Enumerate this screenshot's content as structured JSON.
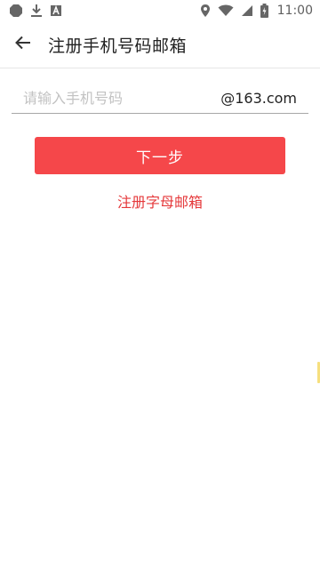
{
  "status_bar": {
    "time": "11:00",
    "left_icons": [
      "app-icon",
      "download-icon",
      "a-box-icon"
    ],
    "right_icons": [
      "location-icon",
      "wifi-icon",
      "cell-signal-icon",
      "battery-charging-icon"
    ]
  },
  "toolbar": {
    "title": "注册手机号码邮箱"
  },
  "form": {
    "phone_placeholder": "请输入手机号码",
    "phone_value": "",
    "domain_suffix": "@163.com",
    "next_label": "下一步",
    "alt_link_label": "注册字母邮箱"
  },
  "colors": {
    "accent": "#f5474a",
    "link": "#e5393b",
    "placeholder": "#c2c2c2"
  }
}
